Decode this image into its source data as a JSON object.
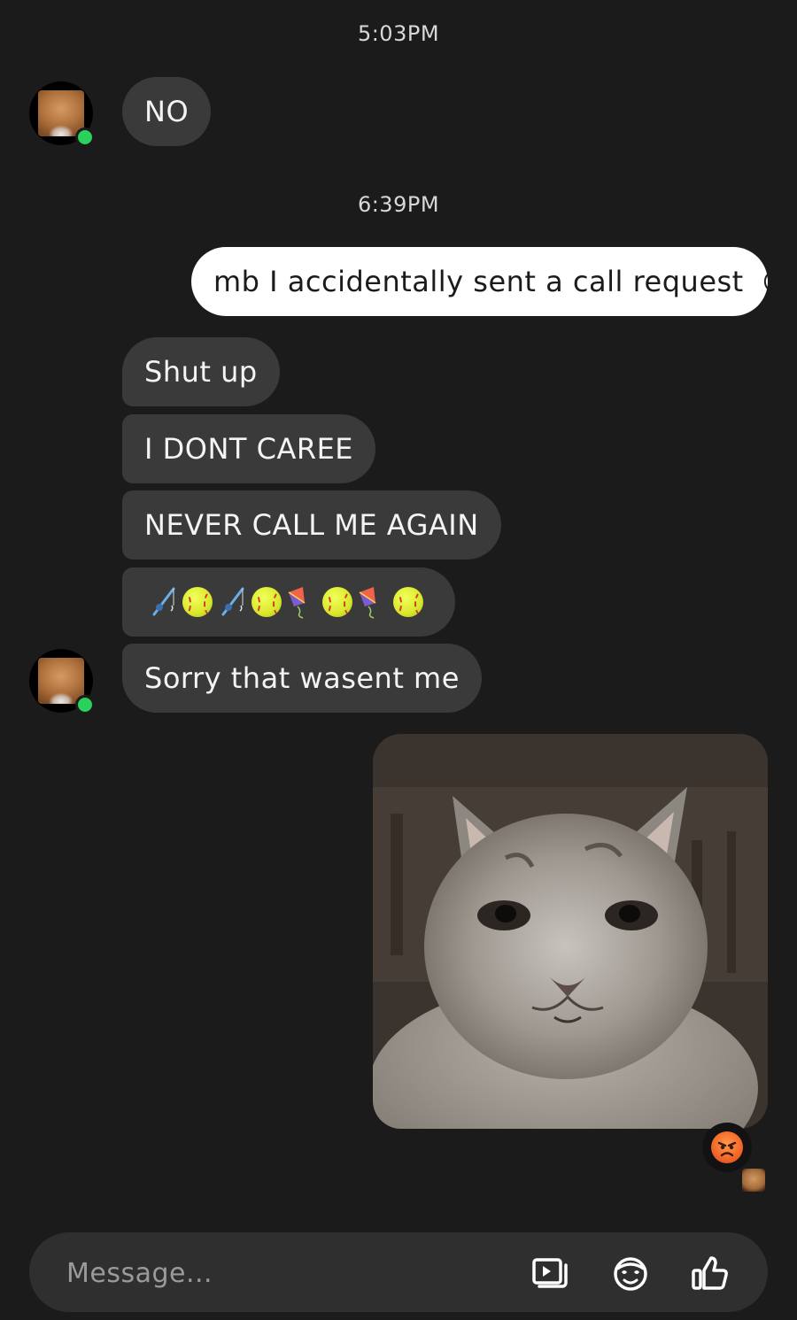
{
  "conversation": {
    "timestamps": [
      "5:03PM",
      "6:39PM"
    ],
    "messages": {
      "no": "NO",
      "mb": "mb I accidentally sent a call request",
      "mb_emoji": "😅",
      "shut_up": "Shut up",
      "dont_care": "I DONT CAREE",
      "never_call": "NEVER CALL ME AGAIN",
      "emoji_sequence": [
        "fishing-rod",
        "softball",
        "fishing-rod",
        "softball",
        "kite",
        "softball",
        "kite",
        "softball"
      ],
      "sorry": "Sorry that wasent me"
    },
    "photo": {
      "subject": "cat"
    },
    "reaction": {
      "emoji": "angry-face"
    }
  },
  "composer": {
    "placeholder": "Message...",
    "icons": [
      "gallery-icon",
      "sticker-icon",
      "thumbs-up-icon"
    ]
  },
  "colors": {
    "background": "#1b1b1c",
    "incoming_bubble": "#3a3a3b",
    "outgoing_bubble": "#ffffff",
    "online_dot": "#2ad15a",
    "composer": "#2f2f30"
  }
}
